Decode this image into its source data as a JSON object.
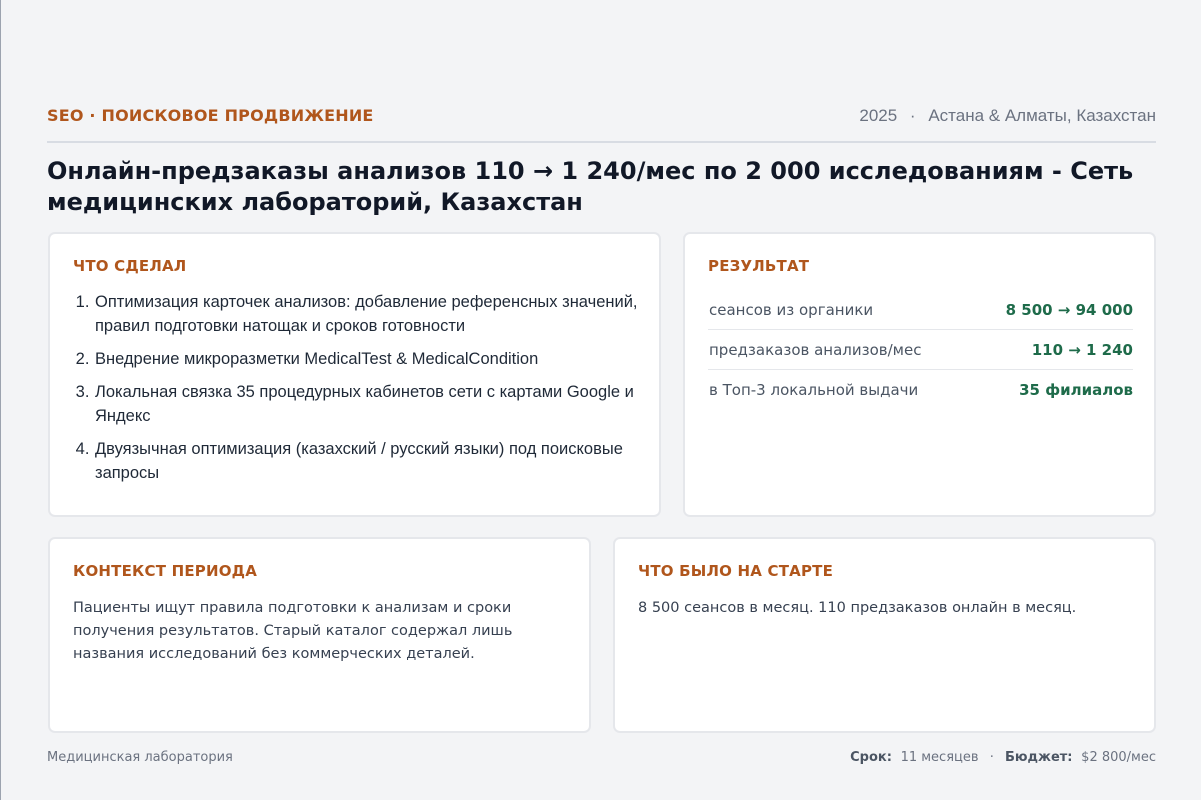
{
  "header": {
    "eyebrow": "SEO · ПОИСКОВОЕ ПРОДВИЖЕНИЕ",
    "year": "2025",
    "separator": "·",
    "location": "Астана & Алматы, Казахстан"
  },
  "title": "Онлайн-предзаказы анализов 110 → 1 240/мес по 2 000 исследованиям - Сеть медицинских лабораторий, Казахстан",
  "what_did": {
    "heading": "ЧТО СДЕЛАЛ",
    "items": [
      "Оптимизация карточек анализов: добавление референсных значений, правил подготовки натощак и сроков готовности",
      "Внедрение микроразметки MedicalTest & MedicalCondition",
      "Локальная связка 35 процедурных кабинетов сети с картами Google и Яндекс",
      "Двуязычная оптимизация (казахский / русский языки) под поисковые запросы"
    ]
  },
  "result": {
    "heading": "РЕЗУЛЬТАТ",
    "metrics": [
      {
        "label": "сеансов из органики",
        "value": "8 500 → 94 000"
      },
      {
        "label": "предзаказов анализов/мес",
        "value": "110 → 1 240"
      },
      {
        "label": "в Топ-3 локальной выдачи",
        "value": "35 филиалов"
      }
    ]
  },
  "context": {
    "heading": "КОНТЕКСТ ПЕРИОДА",
    "text": "Пациенты ищут правила подготовки к анализам и сроки получения результатов. Старый каталог содержал лишь названия исследований без коммерческих деталей."
  },
  "start": {
    "heading": "ЧТО БЫЛО НА СТАРТЕ",
    "text": "8 500 сеансов в месяц. 110 предзаказов онлайн в месяц."
  },
  "footer": {
    "industry": "Медицинская лаборатория",
    "term_label": "Срок:",
    "term_value": "11 месяцев",
    "separator": "·",
    "budget_label": "Бюджет:",
    "budget_value": "$2 800/мес"
  },
  "colors": {
    "accent": "#b0561c",
    "result_green": "#1e6b4a",
    "background": "#f3f4f6"
  }
}
